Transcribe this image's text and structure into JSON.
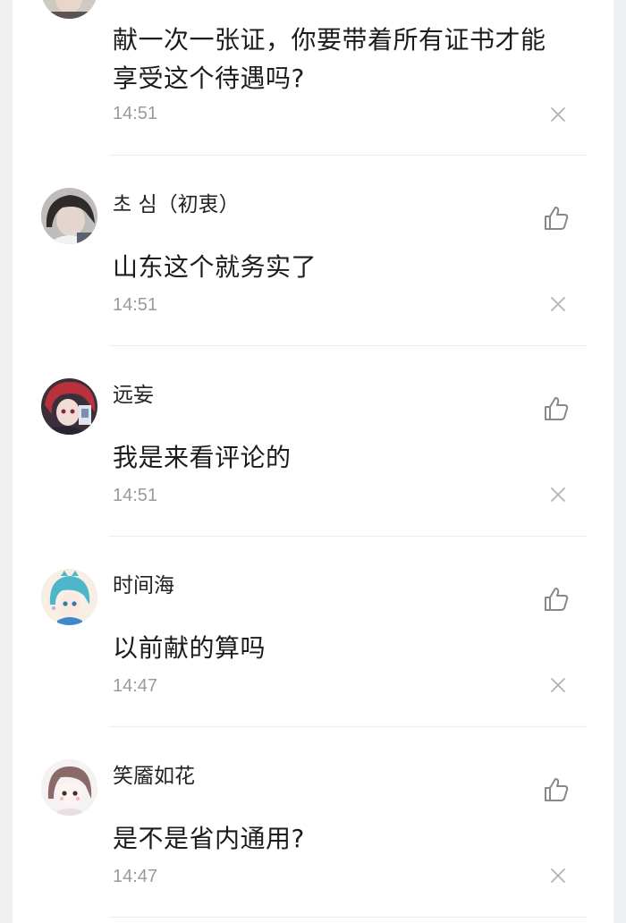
{
  "comments": [
    {
      "username": "",
      "text": "献一次一张证，你要带着所有证书才能享受这个待遇吗?",
      "time": "14:51",
      "avatar": "portrait-avatar"
    },
    {
      "username": "초 심（初衷）",
      "text": "山东这个就务实了",
      "time": "14:51",
      "avatar": "portrait-avatar"
    },
    {
      "username": "远妄",
      "text": "我是来看评论的",
      "time": "14:51",
      "avatar": "anime-avatar"
    },
    {
      "username": "时间海",
      "text": "以前献的算吗",
      "time": "14:47",
      "avatar": "anime-avatar"
    },
    {
      "username": "笑靥如花",
      "text": "是不是省内通用?",
      "time": "14:47",
      "avatar": "cartoon-girl-avatar"
    }
  ],
  "icons": {
    "like": "thumbs-up-icon",
    "close": "close-icon"
  },
  "colors": {
    "text_primary": "#1c1c1c",
    "text_secondary": "#9a9a9a",
    "divider": "#ececec",
    "background": "#ffffff"
  }
}
